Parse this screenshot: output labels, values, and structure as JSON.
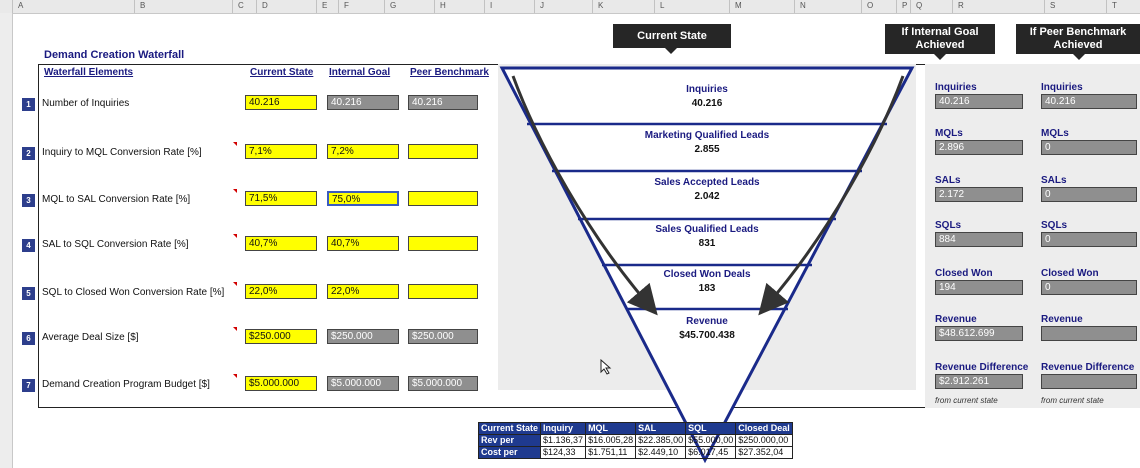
{
  "sheet": {
    "columns": [
      "A",
      "B",
      "C",
      "D",
      "E",
      "F",
      "G",
      "H",
      "I",
      "J",
      "K",
      "L",
      "M",
      "N",
      "O",
      "P",
      "Q",
      "R",
      "S",
      "T"
    ],
    "title": "Demand Creation Waterfall",
    "headers": {
      "elements": "Waterfall Elements",
      "current": "Current State",
      "internal": "Internal Goal",
      "peer": "Peer Benchmark"
    }
  },
  "rows": [
    {
      "num": "1",
      "label": "Number of Inquiries",
      "current": "40.216",
      "internal": "40.216",
      "peer": "40.216"
    },
    {
      "num": "2",
      "label": "Inquiry to MQL Conversion Rate [%]",
      "current": "7,1%",
      "internal": "7,2%",
      "peer": ""
    },
    {
      "num": "3",
      "label": "MQL to SAL Conversion Rate [%]",
      "current": "71,5%",
      "internal": "75,0%",
      "peer": ""
    },
    {
      "num": "4",
      "label": "SAL to SQL Conversion Rate [%]",
      "current": "40,7%",
      "internal": "40,7%",
      "peer": ""
    },
    {
      "num": "5",
      "label": "SQL to Closed Won Conversion Rate [%]",
      "current": "22,0%",
      "internal": "22,0%",
      "peer": ""
    },
    {
      "num": "6",
      "label": "Average Deal Size [$]",
      "current": "$250.000",
      "internal": "$250.000",
      "peer": "$250.000"
    },
    {
      "num": "7",
      "label": "Demand Creation Program Budget [$]",
      "current": "$5.000.000",
      "internal": "$5.000.000",
      "peer": "$5.000.000"
    }
  ],
  "bubbles": {
    "current": "Current State",
    "goal_line1": "If Internal Goal",
    "goal_line2": "Achieved",
    "peer_line1": "If Peer Benchmark",
    "peer_line2": "Achieved"
  },
  "funnel": [
    {
      "name": "Inquiries",
      "value": "40.216"
    },
    {
      "name": "Marketing Qualified Leads",
      "value": "2.855"
    },
    {
      "name": "Sales Accepted Leads",
      "value": "2.042"
    },
    {
      "name": "Sales Qualified Leads",
      "value": "831"
    },
    {
      "name": "Closed Won Deals",
      "value": "183"
    },
    {
      "name": "Revenue",
      "value": "$45.700.438"
    }
  ],
  "outcomes": [
    {
      "label_goal": "Inquiries",
      "goal": "40.216",
      "label_peer": "Inquiries",
      "peer": "40.216"
    },
    {
      "label_goal": "MQLs",
      "goal": "2.896",
      "label_peer": "MQLs",
      "peer": "0"
    },
    {
      "label_goal": "SALs",
      "goal": "2.172",
      "label_peer": "SALs",
      "peer": "0"
    },
    {
      "label_goal": "SQLs",
      "goal": "884",
      "label_peer": "SQLs",
      "peer": "0"
    },
    {
      "label_goal": "Closed Won",
      "goal": "194",
      "label_peer": "Closed Won",
      "peer": "0"
    },
    {
      "label_goal": "Revenue",
      "goal": "$48.612.699",
      "label_peer": "Revenue",
      "peer": ""
    },
    {
      "label_goal": "Revenue Difference",
      "goal": "$2.912.261",
      "label_peer": "Revenue Difference",
      "peer": ""
    }
  ],
  "notes": {
    "goal": "from current state",
    "peer": "from current state"
  },
  "bottom_table": {
    "header": [
      "Current State",
      "Inquiry",
      "MQL",
      "SAL",
      "SQL",
      "Closed Deal"
    ],
    "rows": [
      [
        "Rev per",
        "$1.136,37",
        "$16.005,28",
        "$22.385,00",
        "$55.000,00",
        "$250.000,00"
      ],
      [
        "Cost per",
        "$124,33",
        "$1.751,11",
        "$2.449,10",
        "$6.017,45",
        "$27.352,04"
      ]
    ]
  },
  "colors": {
    "accent": "#1a1a80",
    "input": "#ffff00",
    "calc": "#8f8f8f",
    "funnel": "#1a2a8a",
    "badge": "#2d3e8c"
  }
}
